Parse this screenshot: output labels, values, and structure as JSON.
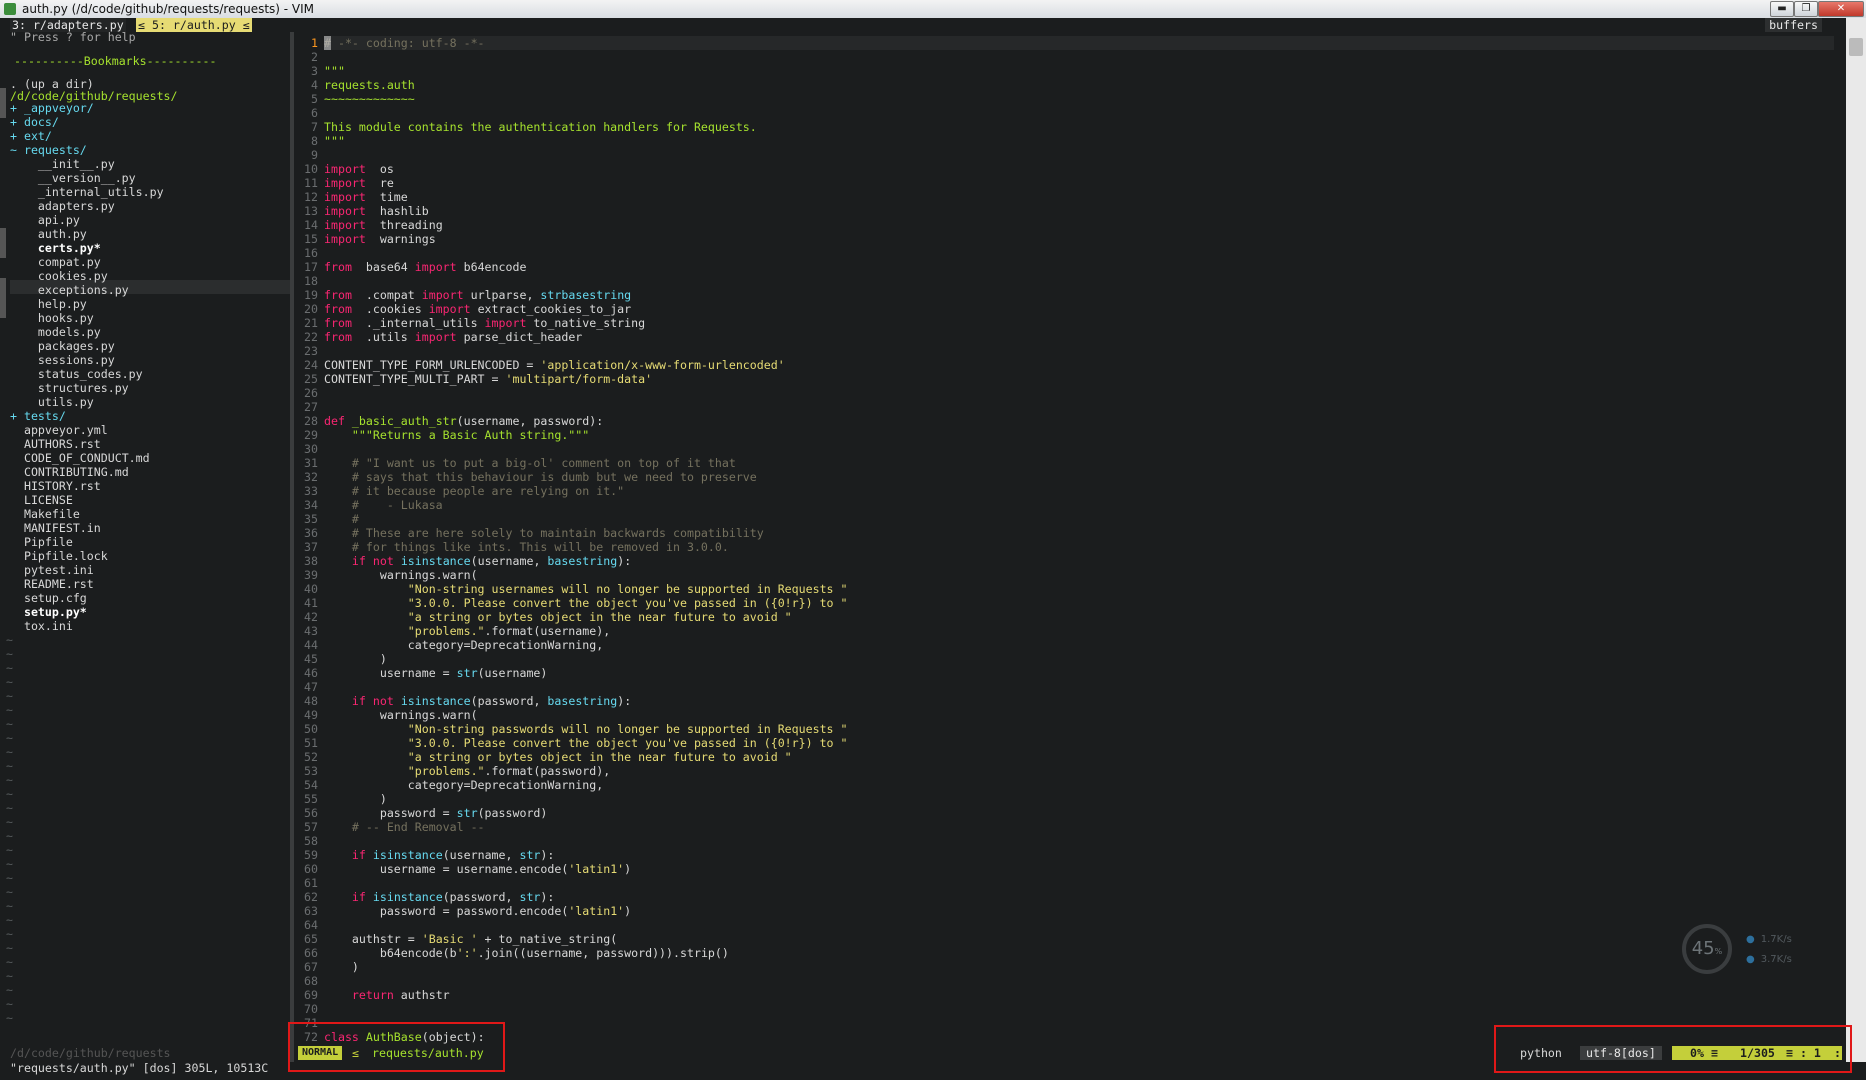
{
  "window": {
    "title": "auth.py (/d/code/github/requests/requests) - VIM",
    "controls": {
      "minimize": "▬",
      "maximize": "❐",
      "close": "✕"
    }
  },
  "tabline": {
    "tab1": "3: r/adapters.py",
    "tab2": "≤ 5: r/auth.py ≤",
    "buffers_label": "buffers"
  },
  "tree": {
    "help": "\" Press ? for help",
    "bookmarks": "----------Bookmarks----------",
    "up_dir": ". (up a dir)",
    "root": "/d/code/github/requests/",
    "entries": [
      {
        "prefix": "+ ",
        "name": "_appveyor/",
        "type": "dir"
      },
      {
        "prefix": "+ ",
        "name": "docs/",
        "type": "dir"
      },
      {
        "prefix": "+ ",
        "name": "ext/",
        "type": "dir"
      },
      {
        "prefix": "~ ",
        "name": "requests/",
        "type": "dir"
      },
      {
        "prefix": "    ",
        "name": "__init__.py",
        "type": "file"
      },
      {
        "prefix": "    ",
        "name": "__version__.py",
        "type": "file"
      },
      {
        "prefix": "    ",
        "name": "_internal_utils.py",
        "type": "file"
      },
      {
        "prefix": "    ",
        "name": "adapters.py",
        "type": "file"
      },
      {
        "prefix": "    ",
        "name": "api.py",
        "type": "file"
      },
      {
        "prefix": "    ",
        "name": "auth.py",
        "type": "file"
      },
      {
        "prefix": "    ",
        "name": "certs.py*",
        "type": "bold"
      },
      {
        "prefix": "    ",
        "name": "compat.py",
        "type": "file"
      },
      {
        "prefix": "    ",
        "name": "cookies.py",
        "type": "file"
      },
      {
        "prefix": "    ",
        "name": "exceptions.py",
        "type": "file"
      },
      {
        "prefix": "    ",
        "name": "help.py",
        "type": "file"
      },
      {
        "prefix": "    ",
        "name": "hooks.py",
        "type": "file"
      },
      {
        "prefix": "    ",
        "name": "models.py",
        "type": "file"
      },
      {
        "prefix": "    ",
        "name": "packages.py",
        "type": "file"
      },
      {
        "prefix": "    ",
        "name": "sessions.py",
        "type": "file"
      },
      {
        "prefix": "    ",
        "name": "status_codes.py",
        "type": "file"
      },
      {
        "prefix": "    ",
        "name": "structures.py",
        "type": "file"
      },
      {
        "prefix": "    ",
        "name": "utils.py",
        "type": "file"
      },
      {
        "prefix": "+ ",
        "name": "tests/",
        "type": "dir"
      },
      {
        "prefix": "  ",
        "name": "appveyor.yml",
        "type": "file"
      },
      {
        "prefix": "  ",
        "name": "AUTHORS.rst",
        "type": "file"
      },
      {
        "prefix": "  ",
        "name": "CODE_OF_CONDUCT.md",
        "type": "file"
      },
      {
        "prefix": "  ",
        "name": "CONTRIBUTING.md",
        "type": "file"
      },
      {
        "prefix": "  ",
        "name": "HISTORY.rst",
        "type": "file"
      },
      {
        "prefix": "  ",
        "name": "LICENSE",
        "type": "file"
      },
      {
        "prefix": "  ",
        "name": "Makefile",
        "type": "file"
      },
      {
        "prefix": "  ",
        "name": "MANIFEST.in",
        "type": "file"
      },
      {
        "prefix": "  ",
        "name": "Pipfile",
        "type": "file"
      },
      {
        "prefix": "  ",
        "name": "Pipfile.lock",
        "type": "file"
      },
      {
        "prefix": "  ",
        "name": "pytest.ini",
        "type": "file"
      },
      {
        "prefix": "  ",
        "name": "README.rst",
        "type": "file"
      },
      {
        "prefix": "  ",
        "name": "setup.cfg",
        "type": "file"
      },
      {
        "prefix": "  ",
        "name": "setup.py*",
        "type": "bold"
      },
      {
        "prefix": "  ",
        "name": "tox.ini",
        "type": "file"
      }
    ],
    "tilde_count": 28,
    "tilde": "~",
    "status": "/d/code/github/requests"
  },
  "editor": {
    "lines": [
      [
        [
          "cmt",
          "# -*- coding: utf-8 -*-"
        ]
      ],
      [],
      [
        [
          "doc",
          "\"\"\""
        ]
      ],
      [
        [
          "doc",
          "requests.auth"
        ]
      ],
      [
        [
          "doc",
          "~~~~~~~~~~~~~"
        ]
      ],
      [],
      [
        [
          "doc",
          "This module contains the authentication handlers for Requests."
        ]
      ],
      [
        [
          "doc",
          "\"\"\""
        ]
      ],
      [],
      [
        [
          "kw",
          "import"
        ],
        [
          "",
          "  os"
        ]
      ],
      [
        [
          "kw",
          "import"
        ],
        [
          "",
          "  re"
        ]
      ],
      [
        [
          "kw",
          "import"
        ],
        [
          "",
          "  time"
        ]
      ],
      [
        [
          "kw",
          "import"
        ],
        [
          "",
          "  hashlib"
        ]
      ],
      [
        [
          "kw",
          "import"
        ],
        [
          "",
          "  threading"
        ]
      ],
      [
        [
          "kw",
          "import"
        ],
        [
          "",
          "  warnings"
        ]
      ],
      [],
      [
        [
          "kw",
          "from"
        ],
        [
          "",
          "  base64 "
        ],
        [
          "kw",
          "import"
        ],
        [
          "",
          " b64encode"
        ]
      ],
      [],
      [
        [
          "kw",
          "from"
        ],
        [
          "",
          "  .compat "
        ],
        [
          "kw",
          "import"
        ],
        [
          "",
          " urlparse, "
        ],
        [
          "bi",
          "str"
        ],
        [
          ", "
        ],
        [
          "bi",
          "basestring"
        ]
      ],
      [
        [
          "kw",
          "from"
        ],
        [
          "",
          "  .cookies "
        ],
        [
          "kw",
          "import"
        ],
        [
          "",
          " extract_cookies_to_jar"
        ]
      ],
      [
        [
          "kw",
          "from"
        ],
        [
          "",
          "  ._internal_utils "
        ],
        [
          "kw",
          "import"
        ],
        [
          "",
          " to_native_string"
        ]
      ],
      [
        [
          "kw",
          "from"
        ],
        [
          "",
          "  .utils "
        ],
        [
          "kw",
          "import"
        ],
        [
          "",
          " parse_dict_header"
        ]
      ],
      [],
      [
        [
          "",
          "CONTENT_TYPE_FORM_URLENCODED = "
        ],
        [
          "str",
          "'application/x-www-form-urlencoded'"
        ]
      ],
      [
        [
          "",
          "CONTENT_TYPE_MULTI_PART = "
        ],
        [
          "str",
          "'multipart/form-data'"
        ]
      ],
      [],
      [],
      [
        [
          "kw",
          "def"
        ],
        [
          "fn",
          " _basic_auth_str"
        ],
        [
          "",
          "(username, password):"
        ]
      ],
      [
        [
          "doc",
          "    \"\"\"Returns a Basic Auth string.\"\"\""
        ]
      ],
      [],
      [
        [
          "cmt",
          "    # \"I want us to put a big-ol' comment on top of it that"
        ]
      ],
      [
        [
          "cmt",
          "    # says that this behaviour is dumb but we need to preserve"
        ]
      ],
      [
        [
          "cmt",
          "    # it because people are relying on it.\""
        ]
      ],
      [
        [
          "cmt",
          "    #    - Lukasa"
        ]
      ],
      [
        [
          "cmt",
          "    #"
        ]
      ],
      [
        [
          "cmt",
          "    # These are here solely to maintain backwards compatibility"
        ]
      ],
      [
        [
          "cmt",
          "    # for things like ints. This will be removed in 3.0.0."
        ]
      ],
      [
        [
          "",
          "    "
        ],
        [
          "kw",
          "if"
        ],
        [
          "",
          " "
        ],
        [
          "kw",
          "not"
        ],
        [
          "",
          " "
        ],
        [
          "bi",
          "isinstance"
        ],
        [
          "",
          "(username, "
        ],
        [
          "bi",
          "basestring"
        ],
        [
          "",
          "):"
        ]
      ],
      [
        [
          "",
          "        warnings.warn("
        ]
      ],
      [
        [
          "str",
          "            \"Non-string usernames will no longer be supported in Requests \""
        ]
      ],
      [
        [
          "str",
          "            \"3.0.0. Please convert the object you've passed in ({0!r}) to \""
        ]
      ],
      [
        [
          "str",
          "            \"a string or bytes object in the near future to avoid \""
        ]
      ],
      [
        [
          "str",
          "            \"problems.\""
        ],
        [
          "",
          ".format(username),"
        ]
      ],
      [
        [
          "",
          "            category=DeprecationWarning,"
        ]
      ],
      [
        [
          "",
          "        )"
        ]
      ],
      [
        [
          "",
          "        username = "
        ],
        [
          "bi",
          "str"
        ],
        [
          "",
          "(username)"
        ]
      ],
      [],
      [
        [
          "",
          "    "
        ],
        [
          "kw",
          "if"
        ],
        [
          "",
          " "
        ],
        [
          "kw",
          "not"
        ],
        [
          "",
          " "
        ],
        [
          "bi",
          "isinstance"
        ],
        [
          "",
          "(password, "
        ],
        [
          "bi",
          "basestring"
        ],
        [
          "",
          "):"
        ]
      ],
      [
        [
          "",
          "        warnings.warn("
        ]
      ],
      [
        [
          "str",
          "            \"Non-string passwords will no longer be supported in Requests \""
        ]
      ],
      [
        [
          "str",
          "            \"3.0.0. Please convert the object you've passed in ({0!r}) to \""
        ]
      ],
      [
        [
          "str",
          "            \"a string or bytes object in the near future to avoid \""
        ]
      ],
      [
        [
          "str",
          "            \"problems.\""
        ],
        [
          "",
          ".format(password),"
        ]
      ],
      [
        [
          "",
          "            category=DeprecationWarning,"
        ]
      ],
      [
        [
          "",
          "        )"
        ]
      ],
      [
        [
          "",
          "        password = "
        ],
        [
          "bi",
          "str"
        ],
        [
          "",
          "(password)"
        ]
      ],
      [
        [
          "cmt",
          "    # -- End Removal --"
        ]
      ],
      [],
      [
        [
          "",
          "    "
        ],
        [
          "kw",
          "if"
        ],
        [
          "",
          " "
        ],
        [
          "bi",
          "isinstance"
        ],
        [
          "",
          "(username, "
        ],
        [
          "bi",
          "str"
        ],
        [
          "",
          "):"
        ]
      ],
      [
        [
          "",
          "        username = username.encode("
        ],
        [
          "str",
          "'latin1'"
        ],
        [
          "",
          ")"
        ]
      ],
      [],
      [
        [
          "",
          "    "
        ],
        [
          "kw",
          "if"
        ],
        [
          "",
          " "
        ],
        [
          "bi",
          "isinstance"
        ],
        [
          "",
          "(password, "
        ],
        [
          "bi",
          "str"
        ],
        [
          "",
          "):"
        ]
      ],
      [
        [
          "",
          "        password = password.encode("
        ],
        [
          "str",
          "'latin1'"
        ],
        [
          "",
          ")"
        ]
      ],
      [],
      [
        [
          "",
          "    authstr = "
        ],
        [
          "str",
          "'Basic '"
        ],
        [
          "",
          " + to_native_string("
        ]
      ],
      [
        [
          "",
          "        b64encode(b"
        ],
        [
          "str",
          "':'"
        ],
        [
          "",
          ".join((username, password))).strip()"
        ]
      ],
      [
        [
          "",
          "    )"
        ]
      ],
      [],
      [
        [
          "",
          "    "
        ],
        [
          "kw",
          "return"
        ],
        [
          "",
          " authstr"
        ]
      ],
      [],
      [],
      [
        [
          "kw",
          "class"
        ],
        [
          "fn",
          " AuthBase"
        ],
        [
          "",
          "(object):"
        ]
      ]
    ],
    "line_numbers": [
      "1",
      "2",
      "3",
      "4",
      "5",
      "6",
      "7",
      "8",
      "9",
      "10",
      "11",
      "12",
      "13",
      "14",
      "15",
      "16",
      "17",
      "18",
      "19",
      "20",
      "21",
      "22",
      "23",
      "24",
      "25",
      "26",
      "27",
      "28",
      "29",
      "30",
      "31",
      "32",
      "33",
      "34",
      "35",
      "36",
      "37",
      "38",
      "39",
      "40",
      "41",
      "42",
      "43",
      "44",
      "45",
      "46",
      "47",
      "48",
      "49",
      "50",
      "51",
      "52",
      "53",
      "54",
      "55",
      "56",
      "57",
      "58",
      "59",
      "60",
      "61",
      "62",
      "63",
      "64",
      "65",
      "66",
      "67",
      "68",
      "69",
      "70",
      "71",
      "72"
    ]
  },
  "statusline": {
    "mode": "NORMAL",
    "mode_sep": "≤",
    "filename": "requests/auth.py",
    "filetype": "python",
    "encoding": "utf-8[dos]",
    "percent": "0% ≡",
    "position": "1/305",
    "column": "≡ :  1",
    "pct_end": ":"
  },
  "cmdline": "\"requests/auth.py\" [dos] 305L, 10513C",
  "net_widget": {
    "cpu_value": "45",
    "cpu_unit": "%",
    "upload": "1.7",
    "upload_unit": "K/s",
    "download": "3.7",
    "download_unit": "K/s"
  },
  "colors": {
    "background": "#1b1d1e",
    "keyword": "#f92672",
    "string": "#e6db74",
    "comment": "#75715e",
    "function": "#a6e22e",
    "builtin": "#66d9ef",
    "mode_bg": "#c4cf3a",
    "highlight_box": "#e01818"
  }
}
